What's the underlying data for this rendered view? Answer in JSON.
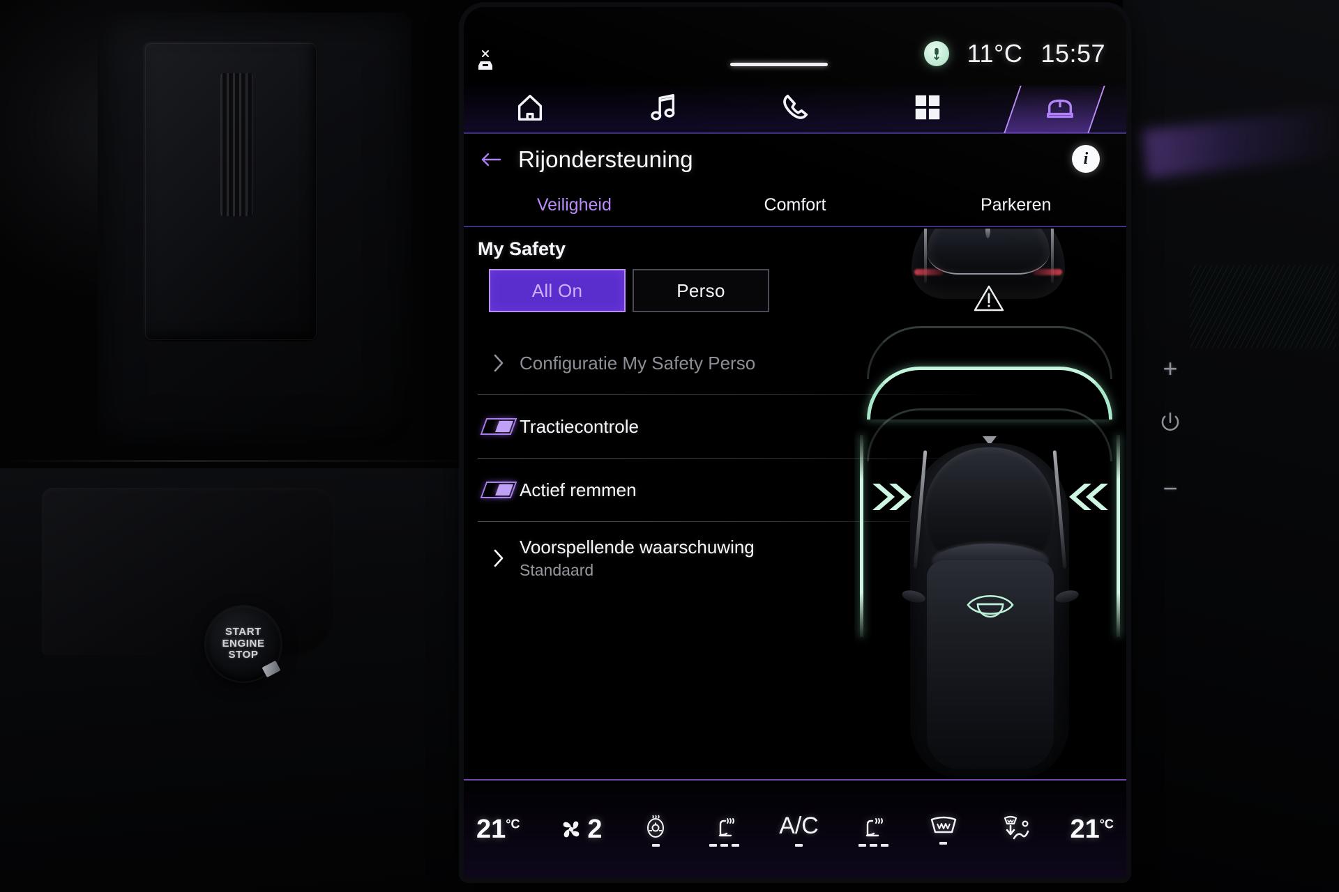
{
  "status_bar": {
    "key_icon": "car-no-key-icon",
    "handle_bar": "drag-handle",
    "assistant_icon": "microphone-icon",
    "outside_temp": "11°C",
    "clock": "15:57"
  },
  "nav_bar": {
    "items": [
      {
        "name": "home",
        "icon": "home-icon",
        "label": "Home",
        "active": false
      },
      {
        "name": "media",
        "icon": "music-note-icon",
        "label": "Media",
        "active": false
      },
      {
        "name": "phone",
        "icon": "phone-handset-icon",
        "label": "Telefoon",
        "active": false
      },
      {
        "name": "apps",
        "icon": "apps-grid-icon",
        "label": "Apps",
        "active": false
      },
      {
        "name": "vehicle",
        "icon": "car-front-icon",
        "label": "Voertuig",
        "active": true
      }
    ]
  },
  "header": {
    "back_icon": "arrow-left-icon",
    "title": "Rijondersteuning",
    "info_icon": "info-icon",
    "info_label": "i"
  },
  "tabs": [
    {
      "label": "Veiligheid",
      "active": true
    },
    {
      "label": "Comfort",
      "active": false
    },
    {
      "label": "Parkeren",
      "active": false
    }
  ],
  "main": {
    "section_title": "My Safety",
    "segmented": {
      "options": [
        {
          "label": "All On",
          "selected": true
        },
        {
          "label": "Perso",
          "selected": false
        }
      ]
    },
    "rows": [
      {
        "type": "link",
        "icon": "chevron-right-icon",
        "label": "Configuratie My Safety Perso",
        "sub": "",
        "disabled": true
      },
      {
        "type": "toggle",
        "icon": "toggle-switch-icon",
        "label": "Tractiecontrole",
        "sub": "",
        "state": "on"
      },
      {
        "type": "toggle",
        "icon": "toggle-switch-icon",
        "label": "Actief remmen",
        "sub": "",
        "state": "on"
      },
      {
        "type": "link",
        "icon": "chevron-right-icon",
        "label": "Voorspellende waarschuwing",
        "sub": "Standaard",
        "disabled": false
      }
    ]
  },
  "visualization": {
    "lead_vehicle": "lead-car-rear",
    "warning_icon": "warning-triangle-icon",
    "distance_arcs": 3,
    "active_arc_index": 2,
    "lane_lines": "lane-markings",
    "left_chevrons": "chevrons-right-icon",
    "right_chevrons": "chevrons-left-icon",
    "ego_sensor_icon": "camera-eye-icon",
    "accent_green": "#c4f5dd",
    "accent_purple": "#b98cf7",
    "warning_color": "#e8ebe8"
  },
  "climate_bar": {
    "left_temp": "21",
    "left_temp_unit": "°C",
    "fan_icon": "fan-icon",
    "fan_speed": "2",
    "controls": [
      {
        "name": "heated-steering-wheel",
        "icon": "steering-wheel-heat-icon",
        "levels": 1,
        "active_levels": 1
      },
      {
        "name": "driver-seat-heater",
        "icon": "seat-heat-icon",
        "levels": 3,
        "active_levels": 3
      },
      {
        "name": "ac-toggle",
        "icon": "ac-icon",
        "label": "A/C",
        "levels": 1,
        "active_levels": 1
      },
      {
        "name": "passenger-seat-heater",
        "icon": "seat-heat-icon",
        "levels": 3,
        "active_levels": 3
      },
      {
        "name": "rear-defrost",
        "icon": "rear-defrost-icon",
        "levels": 1,
        "active_levels": 1
      },
      {
        "name": "air-recirculation",
        "icon": "airflow-recirculate-icon",
        "levels": 0,
        "active_levels": 0
      }
    ],
    "right_temp": "21",
    "right_temp_unit": "°C"
  },
  "hardware": {
    "volume_up": "+",
    "volume_down": "−",
    "power_icon": "power-icon",
    "start_button_line1": "START",
    "start_button_line2": "ENGINE",
    "start_button_line3": "STOP"
  }
}
